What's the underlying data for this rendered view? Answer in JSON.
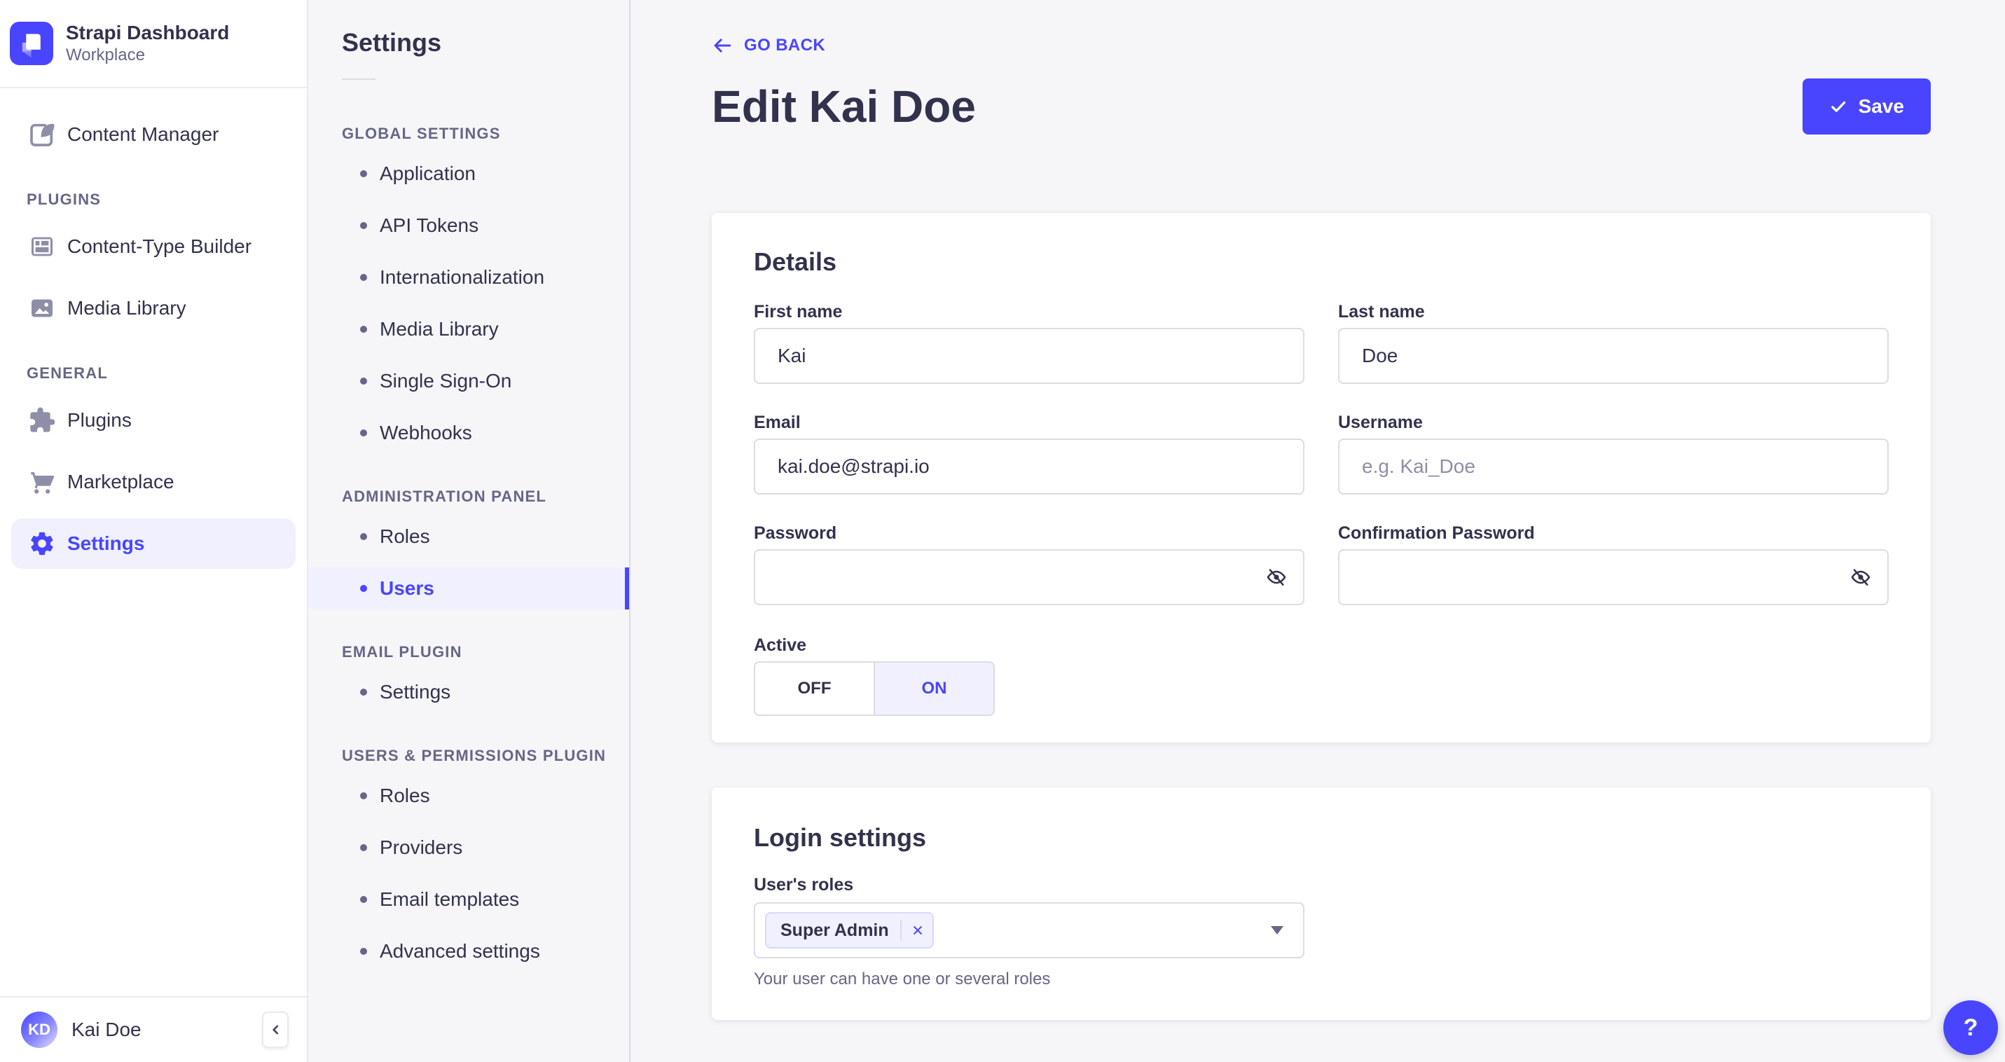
{
  "colors": {
    "primary": "#4945FF",
    "primary_light_bg": "#F0F0FF",
    "app_bg": "#F6F6F9",
    "surface": "#FFFFFF",
    "border": "#DCDCE4",
    "divider": "#EAEAEF",
    "text": "#32324D",
    "text_secondary": "#666687",
    "placeholder": "#8E8EA9"
  },
  "sidebar": {
    "logo_title": "Strapi Dashboard",
    "logo_subtitle": "Workplace",
    "content_manager": {
      "label": "Content Manager",
      "icon": "feather-icon"
    },
    "sections": [
      {
        "header": "PLUGINS",
        "items": [
          {
            "label": "Content-Type Builder",
            "icon": "layout-icon"
          },
          {
            "label": "Media Library",
            "icon": "image-icon"
          }
        ]
      },
      {
        "header": "GENERAL",
        "items": [
          {
            "label": "Plugins",
            "icon": "puzzle-icon"
          },
          {
            "label": "Marketplace",
            "icon": "cart-icon"
          },
          {
            "label": "Settings",
            "icon": "gear-icon",
            "active": true
          }
        ]
      }
    ],
    "user": {
      "initials": "KD",
      "name": "Kai Doe"
    },
    "collapse_icon": "chevron-left-icon"
  },
  "subnav": {
    "title": "Settings",
    "sections": [
      {
        "header": "GLOBAL SETTINGS",
        "items": [
          "Application",
          "API Tokens",
          "Internationalization",
          "Media Library",
          "Single Sign-On",
          "Webhooks"
        ]
      },
      {
        "header": "ADMINISTRATION PANEL",
        "items": [
          "Roles",
          "Users"
        ],
        "active_item": "Users"
      },
      {
        "header": "EMAIL PLUGIN",
        "items": [
          "Settings"
        ]
      },
      {
        "header": "USERS & PERMISSIONS PLUGIN",
        "items": [
          "Roles",
          "Providers",
          "Email templates",
          "Advanced settings"
        ]
      }
    ]
  },
  "header": {
    "back_label": "GO BACK",
    "title": "Edit Kai Doe",
    "save_label": "Save"
  },
  "details": {
    "heading": "Details",
    "fields": {
      "first_name": {
        "label": "First name",
        "value": "Kai"
      },
      "last_name": {
        "label": "Last name",
        "value": "Doe"
      },
      "email": {
        "label": "Email",
        "value": "kai.doe@strapi.io"
      },
      "username": {
        "label": "Username",
        "placeholder": "e.g. Kai_Doe"
      },
      "password": {
        "label": "Password",
        "value": ""
      },
      "confirmation_password": {
        "label": "Confirmation Password",
        "value": ""
      }
    },
    "active_toggle": {
      "label": "Active",
      "off": "OFF",
      "on": "ON",
      "value": "ON"
    }
  },
  "login": {
    "heading": "Login settings",
    "roles_label": "User's roles",
    "role_tag": "Super Admin",
    "helper": "Your user can have one or several roles"
  },
  "help": {
    "label": "?"
  }
}
